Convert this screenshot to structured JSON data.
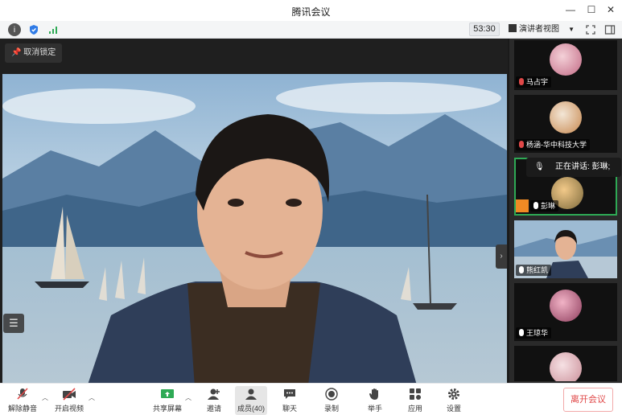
{
  "window": {
    "title": "腾讯会议",
    "minimize": "—",
    "maximize": "☐",
    "close": "✕"
  },
  "topbar": {
    "info_icon": "info-icon",
    "shield_icon": "shield-icon",
    "signal_icon": "signal-icon",
    "timer": "53:30",
    "view_label": "演讲者视图",
    "fullscreen_icon": "fullscreen-icon",
    "layout_icon": "sidebar-layout-icon"
  },
  "stage": {
    "pin_label": "取消锁定",
    "list_icon": "list-icon",
    "collapse_icon": "chevron-right-icon"
  },
  "panel": {
    "speaking_popup": "正在讲话: 彭琳;",
    "participants": [
      {
        "name": "马占宇",
        "mic": "muted"
      },
      {
        "name": "杨涵-华中科技大学",
        "mic": "muted"
      },
      {
        "name": "彭琳",
        "mic": "on",
        "host": true
      },
      {
        "name": "熊红凯",
        "mic": "on"
      },
      {
        "name": "王琼华",
        "mic": "on"
      },
      {
        "name": "",
        "mic": "on"
      }
    ]
  },
  "toolbar": {
    "unmute": "解除静音",
    "start_video": "开启视频",
    "share_screen": "共享屏幕",
    "invite": "邀请",
    "members": "成员(40)",
    "chat": "聊天",
    "record": "录制",
    "raise_hand": "举手",
    "apps": "应用",
    "settings": "设置",
    "leave": "离开会议"
  },
  "colors": {
    "accent_green": "#2eaa55",
    "leave_red": "#e04848",
    "host_orange": "#f08a24"
  }
}
